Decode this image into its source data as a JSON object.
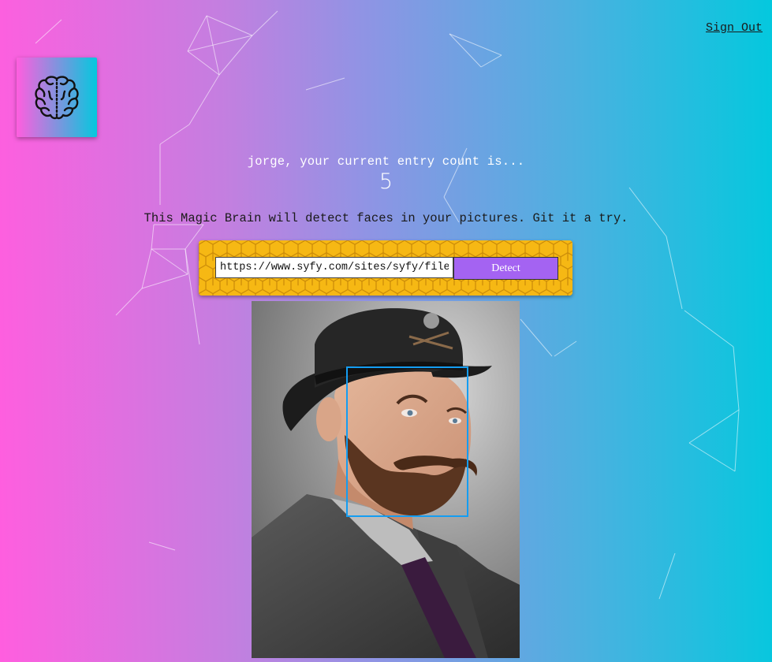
{
  "nav": {
    "sign_out_label": "Sign Out"
  },
  "logo": {
    "icon": "brain-icon"
  },
  "rank": {
    "message": "jorge, your current entry count is...",
    "entry_count": "5"
  },
  "tagline": "This Magic Brain will detect faces in your pictures. Git it a try.",
  "image_form": {
    "url_value": "https://www.syfy.com/sites/syfy/files/",
    "detect_label": "Detect"
  },
  "result": {
    "image_subject": "photo-of-man-in-top-hat",
    "face_box_color": "#149df2"
  },
  "colors": {
    "gradient_start": "#ff5edf",
    "gradient_end": "#04c8de",
    "form_background": "#f6b814",
    "button": "#a463f2"
  }
}
